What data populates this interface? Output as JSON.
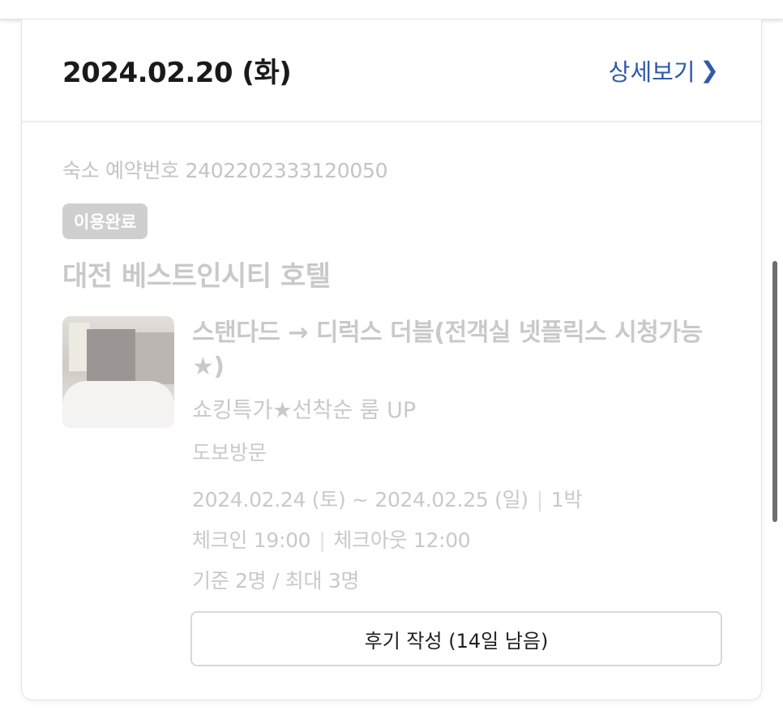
{
  "header": {
    "date": "2024.02.20 (화)",
    "detail_label": "상세보기"
  },
  "reservation": {
    "number_label": "숙소 예약번호 2402202333120050",
    "status_badge": "이용완료",
    "hotel_name": "대전 베스트인시티 호텔",
    "room_name": "스탠다드 → 디럭스 더블(전객실 넷플릭스 시청가능★)",
    "room_promo": "쇼킹특가★선착순 룸 UP",
    "visit_type": "도보방문",
    "stay_dates": "2024.02.24 (토) ~ 2024.02.25 (일)",
    "nights": "1박",
    "checkin": "체크인 19:00",
    "checkout": "체크아웃 12:00",
    "occupancy": "기준 2명 / 최대 3명"
  },
  "actions": {
    "review_button": "후기 작성 (14일 남음)"
  },
  "icons": {
    "detail_chevron": "chevron-right-icon"
  },
  "colors": {
    "link": "#2f5aa8",
    "badge_bg": "#cfcfcf",
    "muted_text": "#c9c9c9"
  }
}
